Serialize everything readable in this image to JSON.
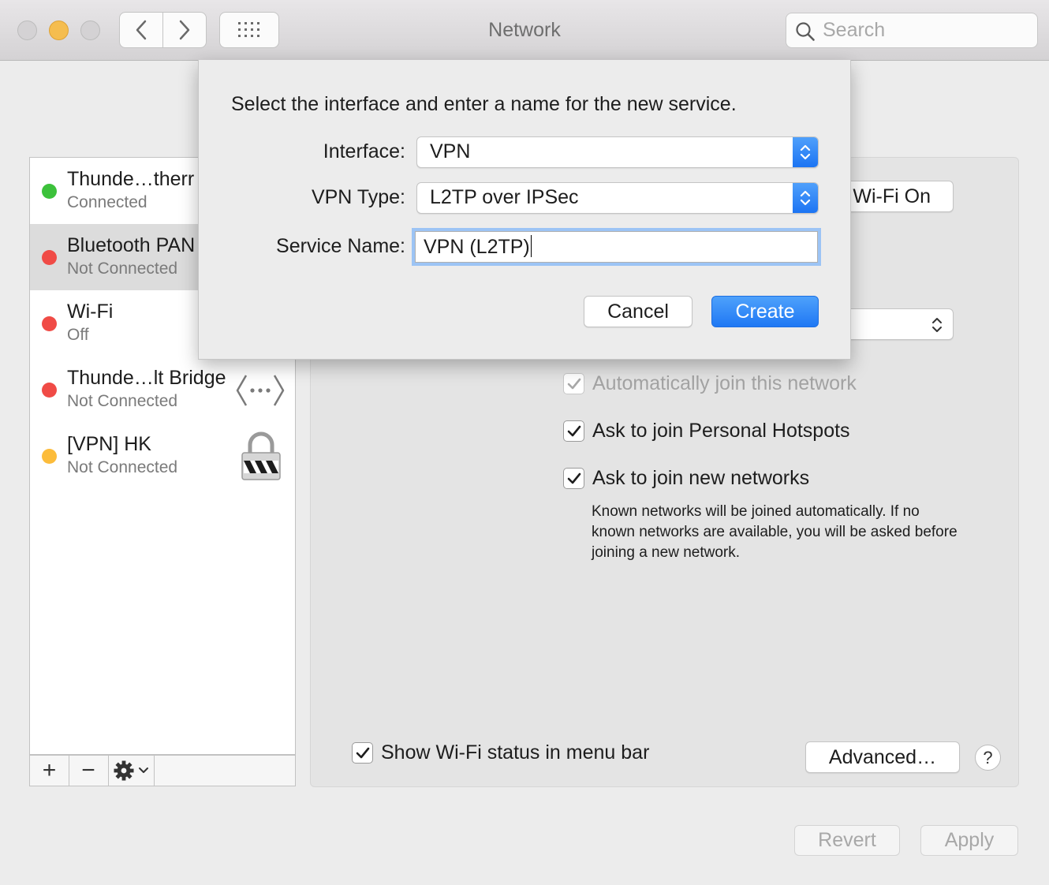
{
  "window": {
    "title": "Network"
  },
  "toolbar": {
    "search_placeholder": "Search"
  },
  "sidebar": {
    "services": [
      {
        "name": "Thunde…therr",
        "status": "Connected",
        "dot_color": "#3cc13b",
        "selected": false
      },
      {
        "name": "Bluetooth PAN",
        "status": "Not Connected",
        "dot_color": "#f04b46",
        "selected": true
      },
      {
        "name": "Wi-Fi",
        "status": "Off",
        "dot_color": "#f04b46",
        "selected": false
      },
      {
        "name": "Thunde…lt Bridge",
        "status": "Not Connected",
        "dot_color": "#f04b46",
        "selected": false
      },
      {
        "name": "[VPN] HK",
        "status": "Not Connected",
        "dot_color": "#fcbc3b",
        "selected": false
      }
    ],
    "add_label": "+",
    "remove_label": "−"
  },
  "panel": {
    "wifi_button": "Wi-Fi On",
    "auto_join_label": "Automatically join this network",
    "ask_hotspots_label": "Ask to join Personal Hotspots",
    "ask_new_label": "Ask to join new networks",
    "ask_new_note": "Known networks will be joined automatically. If no known networks are available, you will be asked before joining a new network.",
    "show_status_label": "Show Wi-Fi status in menu bar",
    "advanced_button": "Advanced…",
    "help_label": "?"
  },
  "footer": {
    "revert_label": "Revert",
    "apply_label": "Apply"
  },
  "sheet": {
    "message": "Select the interface and enter a name for the new service.",
    "interface_label": "Interface:",
    "interface_value": "VPN",
    "vpn_type_label": "VPN Type:",
    "vpn_type_value": "L2TP over IPSec",
    "service_name_label": "Service Name:",
    "service_name_value": "VPN (L2TP)",
    "cancel_label": "Cancel",
    "create_label": "Create"
  },
  "colors": {
    "accent": "#1f78f4",
    "focus_ring": "#9cc4f5"
  }
}
